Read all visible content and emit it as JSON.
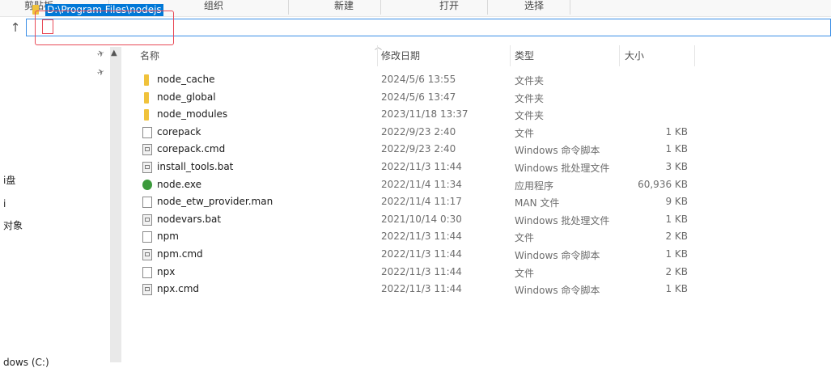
{
  "ribbon": {
    "groups": [
      "剪贴板",
      "组织",
      "新建",
      "打开",
      "选择"
    ]
  },
  "address_bar": {
    "path": "D:\\Program Files\\nodejs"
  },
  "nav_pane": {
    "labels": [
      "i盘",
      "i",
      "对象",
      "dows (C:)"
    ]
  },
  "columns": {
    "name": "名称",
    "date": "修改日期",
    "type": "类型",
    "size": "大小"
  },
  "files": [
    {
      "name": "node_cache",
      "date": "2024/5/6 13:55",
      "type": "文件夹",
      "size": "",
      "icon": "folder-icon"
    },
    {
      "name": "node_global",
      "date": "2024/5/6 13:47",
      "type": "文件夹",
      "size": "",
      "icon": "folder-icon"
    },
    {
      "name": "node_modules",
      "date": "2023/11/18 13:37",
      "type": "文件夹",
      "size": "",
      "icon": "folder-icon"
    },
    {
      "name": "corepack",
      "date": "2022/9/23 2:40",
      "type": "文件",
      "size": "1 KB",
      "icon": "file-icon"
    },
    {
      "name": "corepack.cmd",
      "date": "2022/9/23 2:40",
      "type": "Windows 命令脚本",
      "size": "1 KB",
      "icon": "script-icon"
    },
    {
      "name": "install_tools.bat",
      "date": "2022/11/3 11:44",
      "type": "Windows 批处理文件",
      "size": "3 KB",
      "icon": "script-icon"
    },
    {
      "name": "node.exe",
      "date": "2022/11/4 11:34",
      "type": "应用程序",
      "size": "60,936 KB",
      "icon": "node-exe-icon"
    },
    {
      "name": "node_etw_provider.man",
      "date": "2022/11/4 11:17",
      "type": "MAN 文件",
      "size": "9 KB",
      "icon": "file-icon"
    },
    {
      "name": "nodevars.bat",
      "date": "2021/10/14 0:30",
      "type": "Windows 批处理文件",
      "size": "1 KB",
      "icon": "script-icon"
    },
    {
      "name": "npm",
      "date": "2022/11/3 11:44",
      "type": "文件",
      "size": "2 KB",
      "icon": "file-icon"
    },
    {
      "name": "npm.cmd",
      "date": "2022/11/3 11:44",
      "type": "Windows 命令脚本",
      "size": "1 KB",
      "icon": "script-icon"
    },
    {
      "name": "npx",
      "date": "2022/11/3 11:44",
      "type": "文件",
      "size": "2 KB",
      "icon": "file-icon"
    },
    {
      "name": "npx.cmd",
      "date": "2022/11/3 11:44",
      "type": "Windows 命令脚本",
      "size": "1 KB",
      "icon": "script-icon"
    }
  ],
  "colors": {
    "selection": "#0078d7",
    "address_border": "#3a8ee6",
    "highlight_box": "#e84a57",
    "folder": "#f0c23b",
    "exe": "#3c9a3c"
  }
}
